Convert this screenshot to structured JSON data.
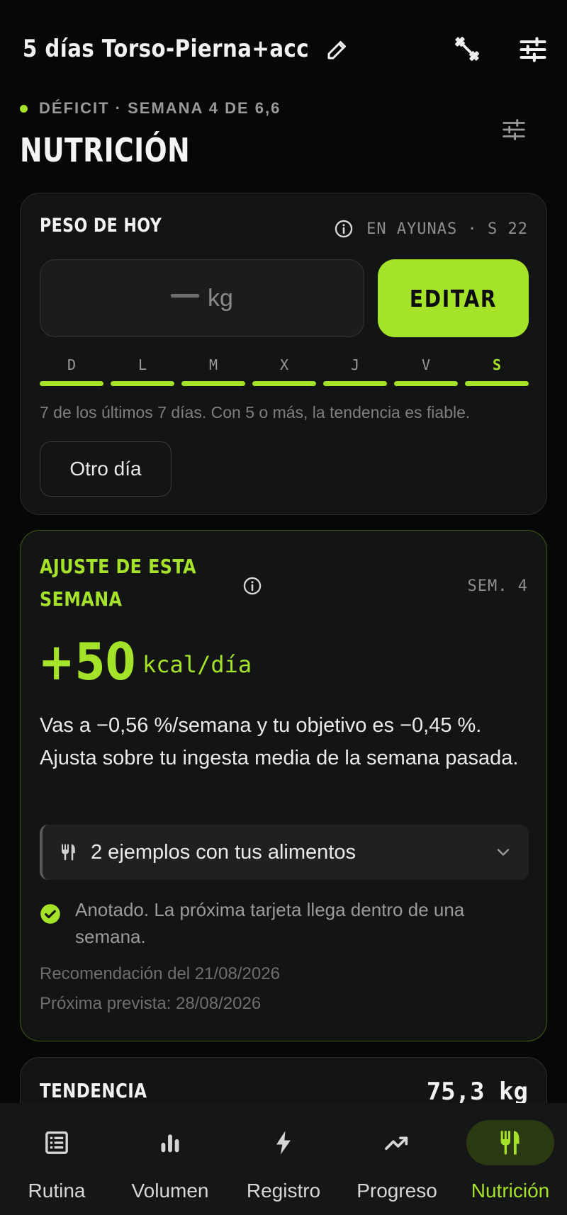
{
  "header": {
    "plan_title": "5 días Torso-Pierna+acc",
    "icons": {
      "edit": "pencil-icon",
      "equipment": "dumbbell-icon",
      "settings": "tune-icon"
    }
  },
  "section": {
    "meta": "DÉFICIT · SEMANA 4 DE 6,6",
    "title": "NUTRICIÓN",
    "accent_color": "#a5e22a"
  },
  "weight_card": {
    "label": "PESO DE HOY",
    "meta": "EN AYUNAS · S 22",
    "input_placeholder": "—",
    "input_unit": "kg",
    "edit_label": "EDITAR",
    "days": [
      {
        "letter": "D",
        "logged": true,
        "today": false
      },
      {
        "letter": "L",
        "logged": true,
        "today": false
      },
      {
        "letter": "M",
        "logged": true,
        "today": false
      },
      {
        "letter": "X",
        "logged": true,
        "today": false
      },
      {
        "letter": "J",
        "logged": true,
        "today": false
      },
      {
        "letter": "V",
        "logged": true,
        "today": false
      },
      {
        "letter": "S",
        "logged": true,
        "today": true
      }
    ],
    "note": "7 de los últimos 7 días. Con 5 o más, la tendencia es fiable.",
    "other_day_label": "Otro día"
  },
  "adjust_card": {
    "title": "AJUSTE DE ESTA SEMANA",
    "week_tag": "SEM. 4",
    "value": "+50",
    "unit": "kcal/día",
    "description": "Vas a −0,56 %/semana y tu objetivo es −0,45 %. Ajusta sobre tu ingesta media de la semana pasada.",
    "examples_label": "2 ejemplos con tus alimentos",
    "logged_text": "Anotado. La próxima tarjeta llega dentro de una semana.",
    "recommendation_date": "Recomendación del 21/08/2026",
    "next_date": "Próxima prevista: 28/08/2026"
  },
  "trend_card": {
    "label": "TENDENCIA",
    "value": "75,3 kg"
  },
  "nav": {
    "items": [
      {
        "label": "Rutina",
        "icon": "list-icon",
        "active": false
      },
      {
        "label": "Volumen",
        "icon": "bar-chart-icon",
        "active": false
      },
      {
        "label": "Registro",
        "icon": "bolt-icon",
        "active": false
      },
      {
        "label": "Progreso",
        "icon": "trending-up-icon",
        "active": false
      },
      {
        "label": "Nutrición",
        "icon": "fork-knife-icon",
        "active": true
      }
    ]
  }
}
